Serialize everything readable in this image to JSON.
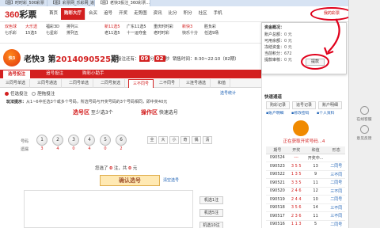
{
  "browser": {
    "tabs": [
      "【图】时时彩_500彩票",
      "【图】彩票网_乐彩网_追号...",
      "【图】老快3投注_360彩票..."
    ]
  },
  "header": {
    "logo_num": "360",
    "logo_text": "彩票",
    "nav": [
      "首页",
      "购彩大厅",
      "合买",
      "追号",
      "开奖",
      "走势图",
      "资讯",
      "比分",
      "积分",
      "社区",
      "手机"
    ],
    "my_center": "我的彩票"
  },
  "lottery_links": {
    "col1": [
      "双色球",
      "七乐彩"
    ],
    "col2": [
      "大乐透",
      "15选5"
    ],
    "col3": [
      "福彩3D",
      "七星彩"
    ],
    "col4": [
      "排列三",
      "排列五"
    ],
    "col5": [
      "新11选5",
      "老11选5"
    ],
    "col6": [
      "广东11选5",
      "十一运夺金"
    ],
    "col7": [
      "重庆时时彩",
      "老时时彩"
    ],
    "col8": [
      "新快3",
      "快乐十分"
    ],
    "col9": [
      "胜负彩",
      "任选9场"
    ]
  },
  "game": {
    "badge": "快3",
    "name": "老快3",
    "issue_prefix": "第",
    "issue": "2014090525",
    "issue_suffix": "期",
    "deadline_label": "投注还有：",
    "min": "09",
    "sec": "02",
    "min_unit": "分",
    "sec_unit": "秒",
    "open_time": "销售时间：8:30~22:10（82期）"
  },
  "modes": {
    "primary": [
      "选号投注",
      "追号投注",
      "购彩小助手"
    ],
    "secondary": [
      "三同号单选",
      "三同号通选",
      "二同号单选",
      "二同号复选",
      "三不同号",
      "二不同号",
      "三连号通选",
      "和值"
    ]
  },
  "options": {
    "opt1": "任选投注",
    "opt2": "胆拖投注",
    "extra": "选号统计"
  },
  "tip": {
    "label": "玩法提示：",
    "text": "从1~6中任选3个或多个号码，所选号码与开奖号码的3个号码相同，即中奖40元"
  },
  "pick": {
    "zone_title": "选号区",
    "zone_hint": "至少选3个",
    "op_title": "操作区",
    "op_hint": "快速选号",
    "row_label": "号码",
    "miss_label": "遗漏",
    "balls": [
      "1",
      "2",
      "3",
      "4",
      "5",
      "6"
    ],
    "misses": [
      "3",
      "4",
      "0",
      "4",
      "0",
      "2"
    ],
    "ops": [
      "全",
      "大",
      "小",
      "奇",
      "偶",
      "清"
    ]
  },
  "selection": {
    "text_a": "您选了",
    "count": "0",
    "text_b": "注，共",
    "amount": "0",
    "text_c": "元",
    "confirm": "确认选号",
    "clear": "清空选号"
  },
  "random_btns": [
    "机选1注",
    "机选5注",
    "机选10注"
  ],
  "account": {
    "title": "资金概况：",
    "rows": [
      {
        "label": "账户总额：",
        "value": "0 元"
      },
      {
        "label": "可用余额：",
        "value": "0 元"
      },
      {
        "label": "冻结资金：",
        "value": "0 元"
      },
      {
        "label": "当前积分：",
        "value": "672"
      },
      {
        "label": "提款审核：",
        "value": "0 元"
      }
    ],
    "recharge": "提款"
  },
  "sidebar": {
    "quick_title": "快速通道",
    "quick_btns": [
      "购彩记录",
      "追号记录",
      "账户明细"
    ],
    "links": [
      "账户明细",
      "修改密码",
      "个人资料"
    ],
    "trend_title": "正在获取开奖号码...4",
    "table_headers": [
      "期号",
      "开奖",
      "和值",
      "形态"
    ],
    "table_rows": [
      [
        "090524",
        "---",
        "开奖中...",
        ""
      ],
      [
        "090523",
        "3 5 5",
        "13",
        "二同号"
      ],
      [
        "090522",
        "1 3 5",
        "9",
        "三不同"
      ],
      [
        "090521",
        "3 3 5",
        "11",
        "二同号"
      ],
      [
        "090520",
        "2 4 6",
        "12",
        "三不同"
      ],
      [
        "090519",
        "2 4 4",
        "10",
        "二同号"
      ],
      [
        "090518",
        "3 5 6",
        "14",
        "三不同"
      ],
      [
        "090517",
        "2 3 6",
        "11",
        "三不同"
      ],
      [
        "090516",
        "1 1 3",
        "5",
        "二同号"
      ]
    ]
  },
  "toolbar": [
    "在线客服",
    "意见反馈"
  ],
  "colors": {
    "brand": "#d32020",
    "annotation": "#e0001b",
    "link": "#1a5fb4"
  }
}
